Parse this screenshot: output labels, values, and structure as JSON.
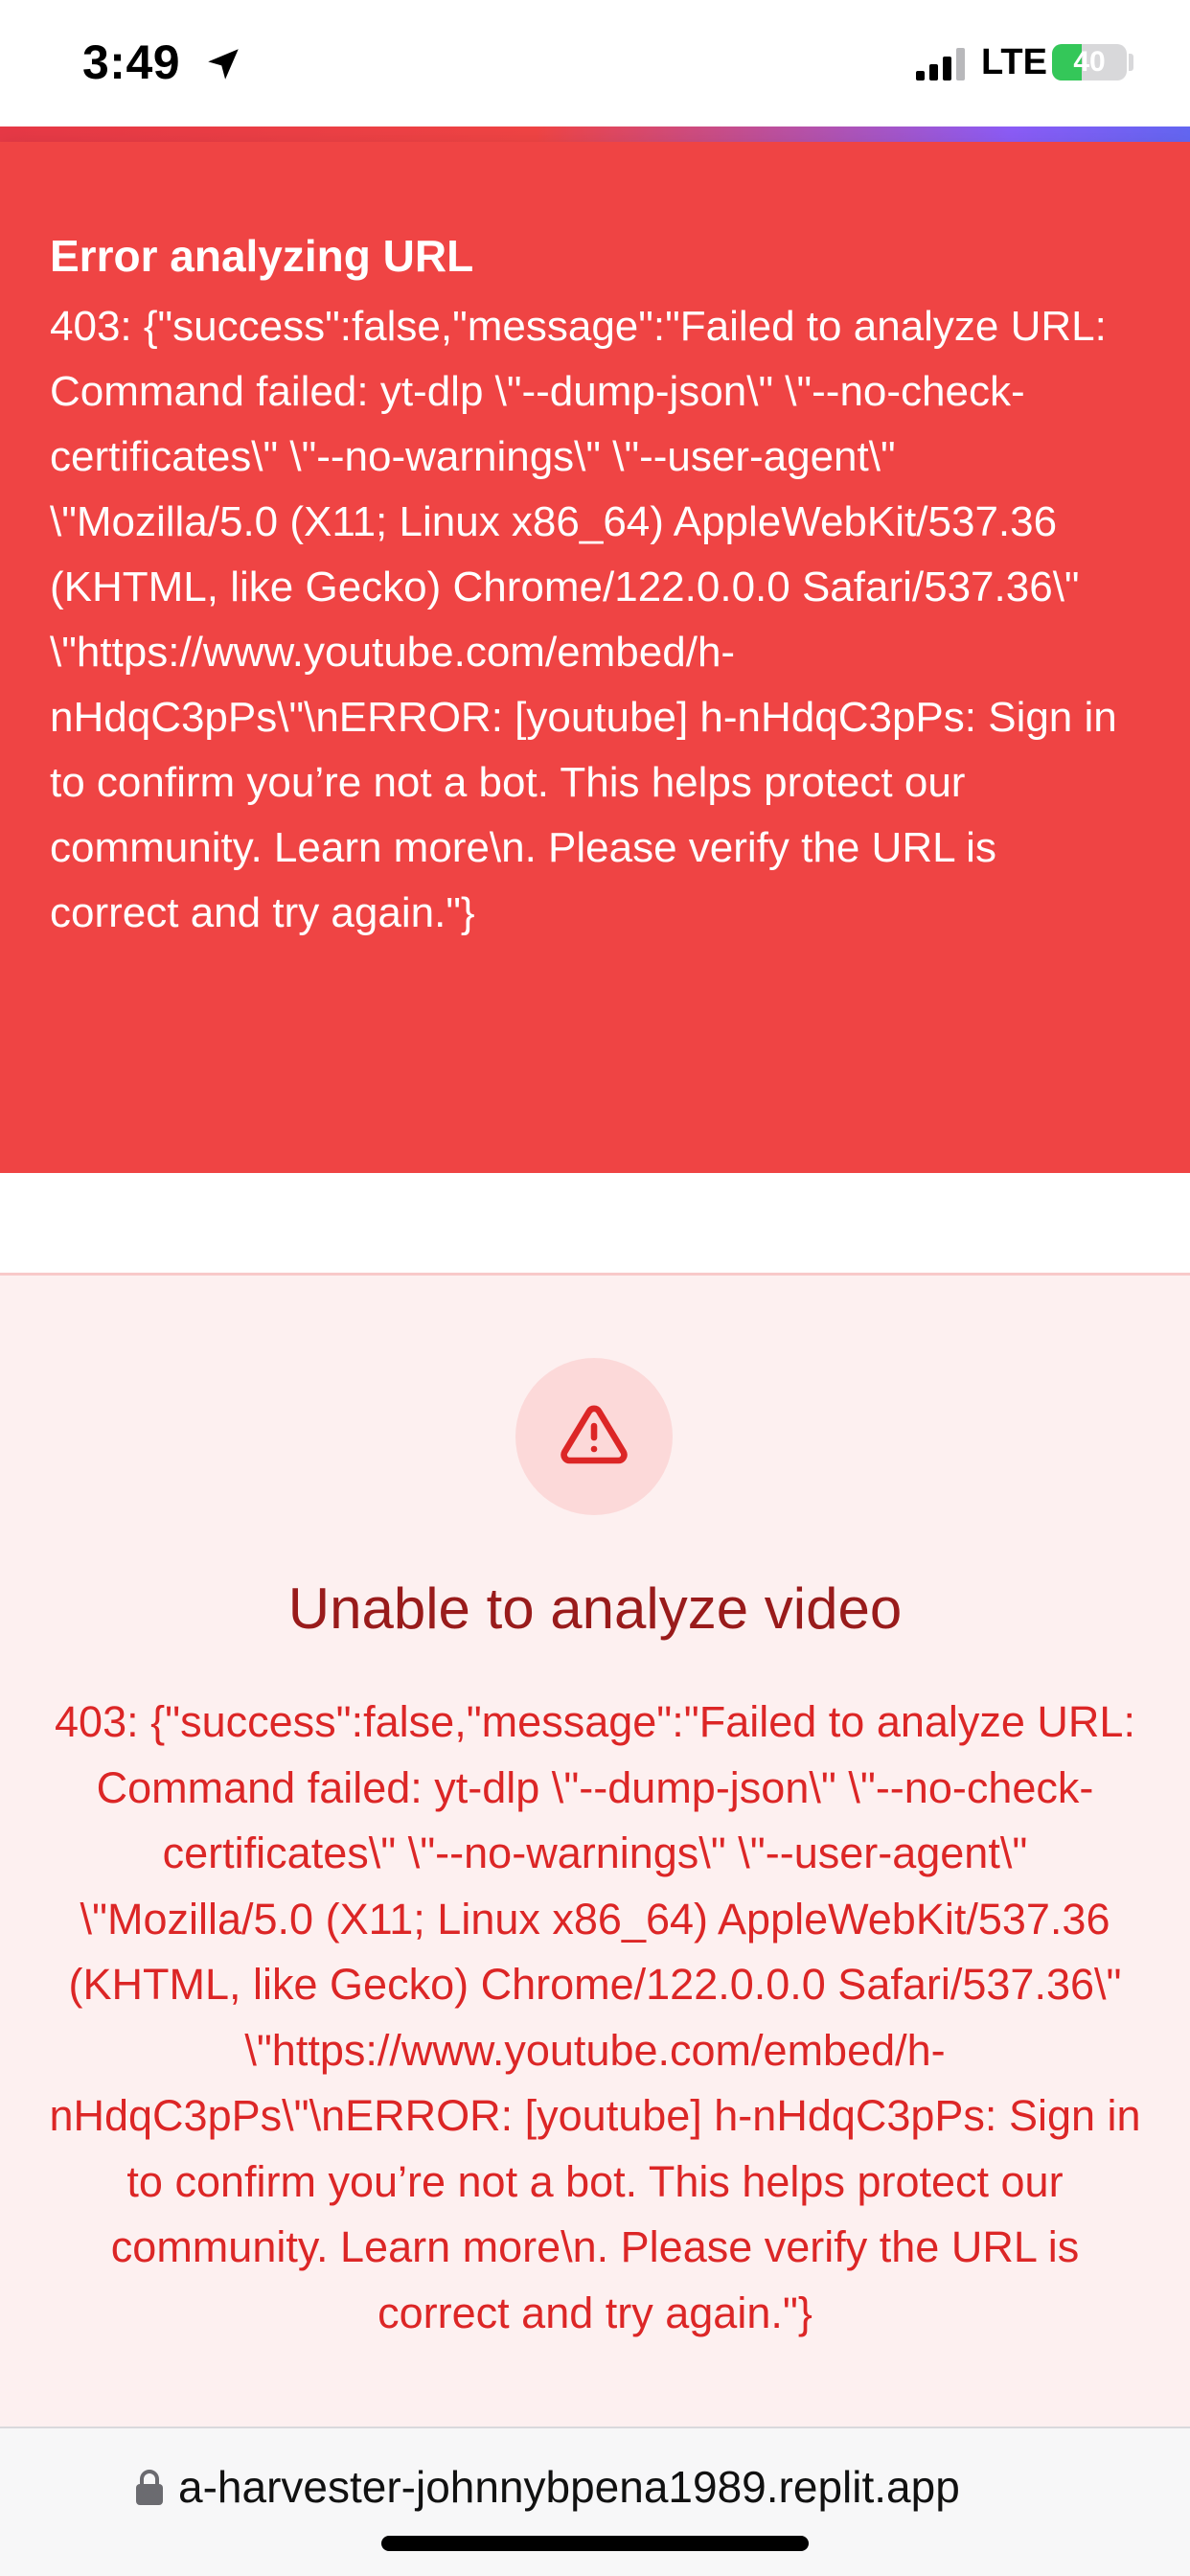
{
  "status_bar": {
    "time": "3:49",
    "location_icon": "location-arrow-icon",
    "signal_icon": "cellular-signal-icon",
    "network": "LTE",
    "battery_percent": 40,
    "battery_label": "40",
    "battery_color": "#34c759"
  },
  "toast": {
    "title": "Error analyzing URL",
    "message": "403: {\"success\":false,\"message\":\"Failed to analyze URL: Command failed: yt-dlp \\\"--dump-json\\\" \\\"--no-check-certificates\\\" \\\"--no-warnings\\\" \\\"--user-agent\\\" \\\"Mozilla/5.0 (X11; Linux x86_64) AppleWebKit/537.36 (KHTML, like Gecko) Chrome/122.0.0.0 Safari/537.36\\\" \\\"https://www.youtube.com/embed/h-nHdqC3pPs\\\"\\nERROR: [youtube] h-nHdqC3pPs: Sign in to confirm you’re not a bot. This helps protect our community. Learn more\\n. Please verify the URL is correct and try again.\"}",
    "background_color": "#ef4444"
  },
  "error_card": {
    "icon": "alert-triangle-icon",
    "title": "Unable to analyze video",
    "message": "403: {\"success\":false,\"message\":\"Failed to analyze URL: Command failed: yt-dlp \\\"--dump-json\\\" \\\"--no-check-certificates\\\" \\\"--no-warnings\\\" \\\"--user-agent\\\" \\\"Mozilla/5.0 (X11; Linux x86_64) AppleWebKit/537.36 (KHTML, like Gecko) Chrome/122.0.0.0 Safari/537.36\\\" \\\"https://www.youtube.com/embed/h-nHdqC3pPs\\\"\\nERROR: [youtube] h-nHdqC3pPs: Sign in to confirm you’re not a bot. This helps protect our community. Learn more\\n. Please verify the URL is correct and try again.\"}",
    "title_color": "#991b1b",
    "message_color": "#dc2626",
    "background_color": "#fdf0f0"
  },
  "browser": {
    "url": "a-harvester-johnnybpena1989.replit.app",
    "lock_icon": "lock-icon"
  }
}
